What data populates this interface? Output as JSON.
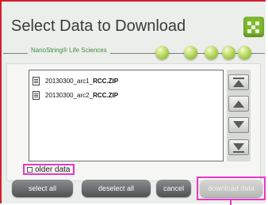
{
  "dialog": {
    "title": "Select Data to Download"
  },
  "brand": {
    "text": "NanoString® Life Sciences"
  },
  "files": [
    {
      "prefix": "20130300_arc1_",
      "ext": "RCC.ZIP"
    },
    {
      "prefix": "20130300_arc2_",
      "ext": "RCC.ZIP"
    }
  ],
  "scroll": {
    "top": "scroll-to-top-icon",
    "up": "scroll-up-icon",
    "down": "scroll-down-icon",
    "bottom": "scroll-to-bottom-icon"
  },
  "options": {
    "older_data_label": "older data",
    "older_data_checked": false
  },
  "buttons": {
    "select_all": "select all",
    "deselect_all": "deselect all",
    "cancel": "cancel",
    "download_data": "download data"
  },
  "colors": {
    "brand_green": "#7fb832",
    "highlight": "#e838c6",
    "frame": "#d61d2a"
  }
}
